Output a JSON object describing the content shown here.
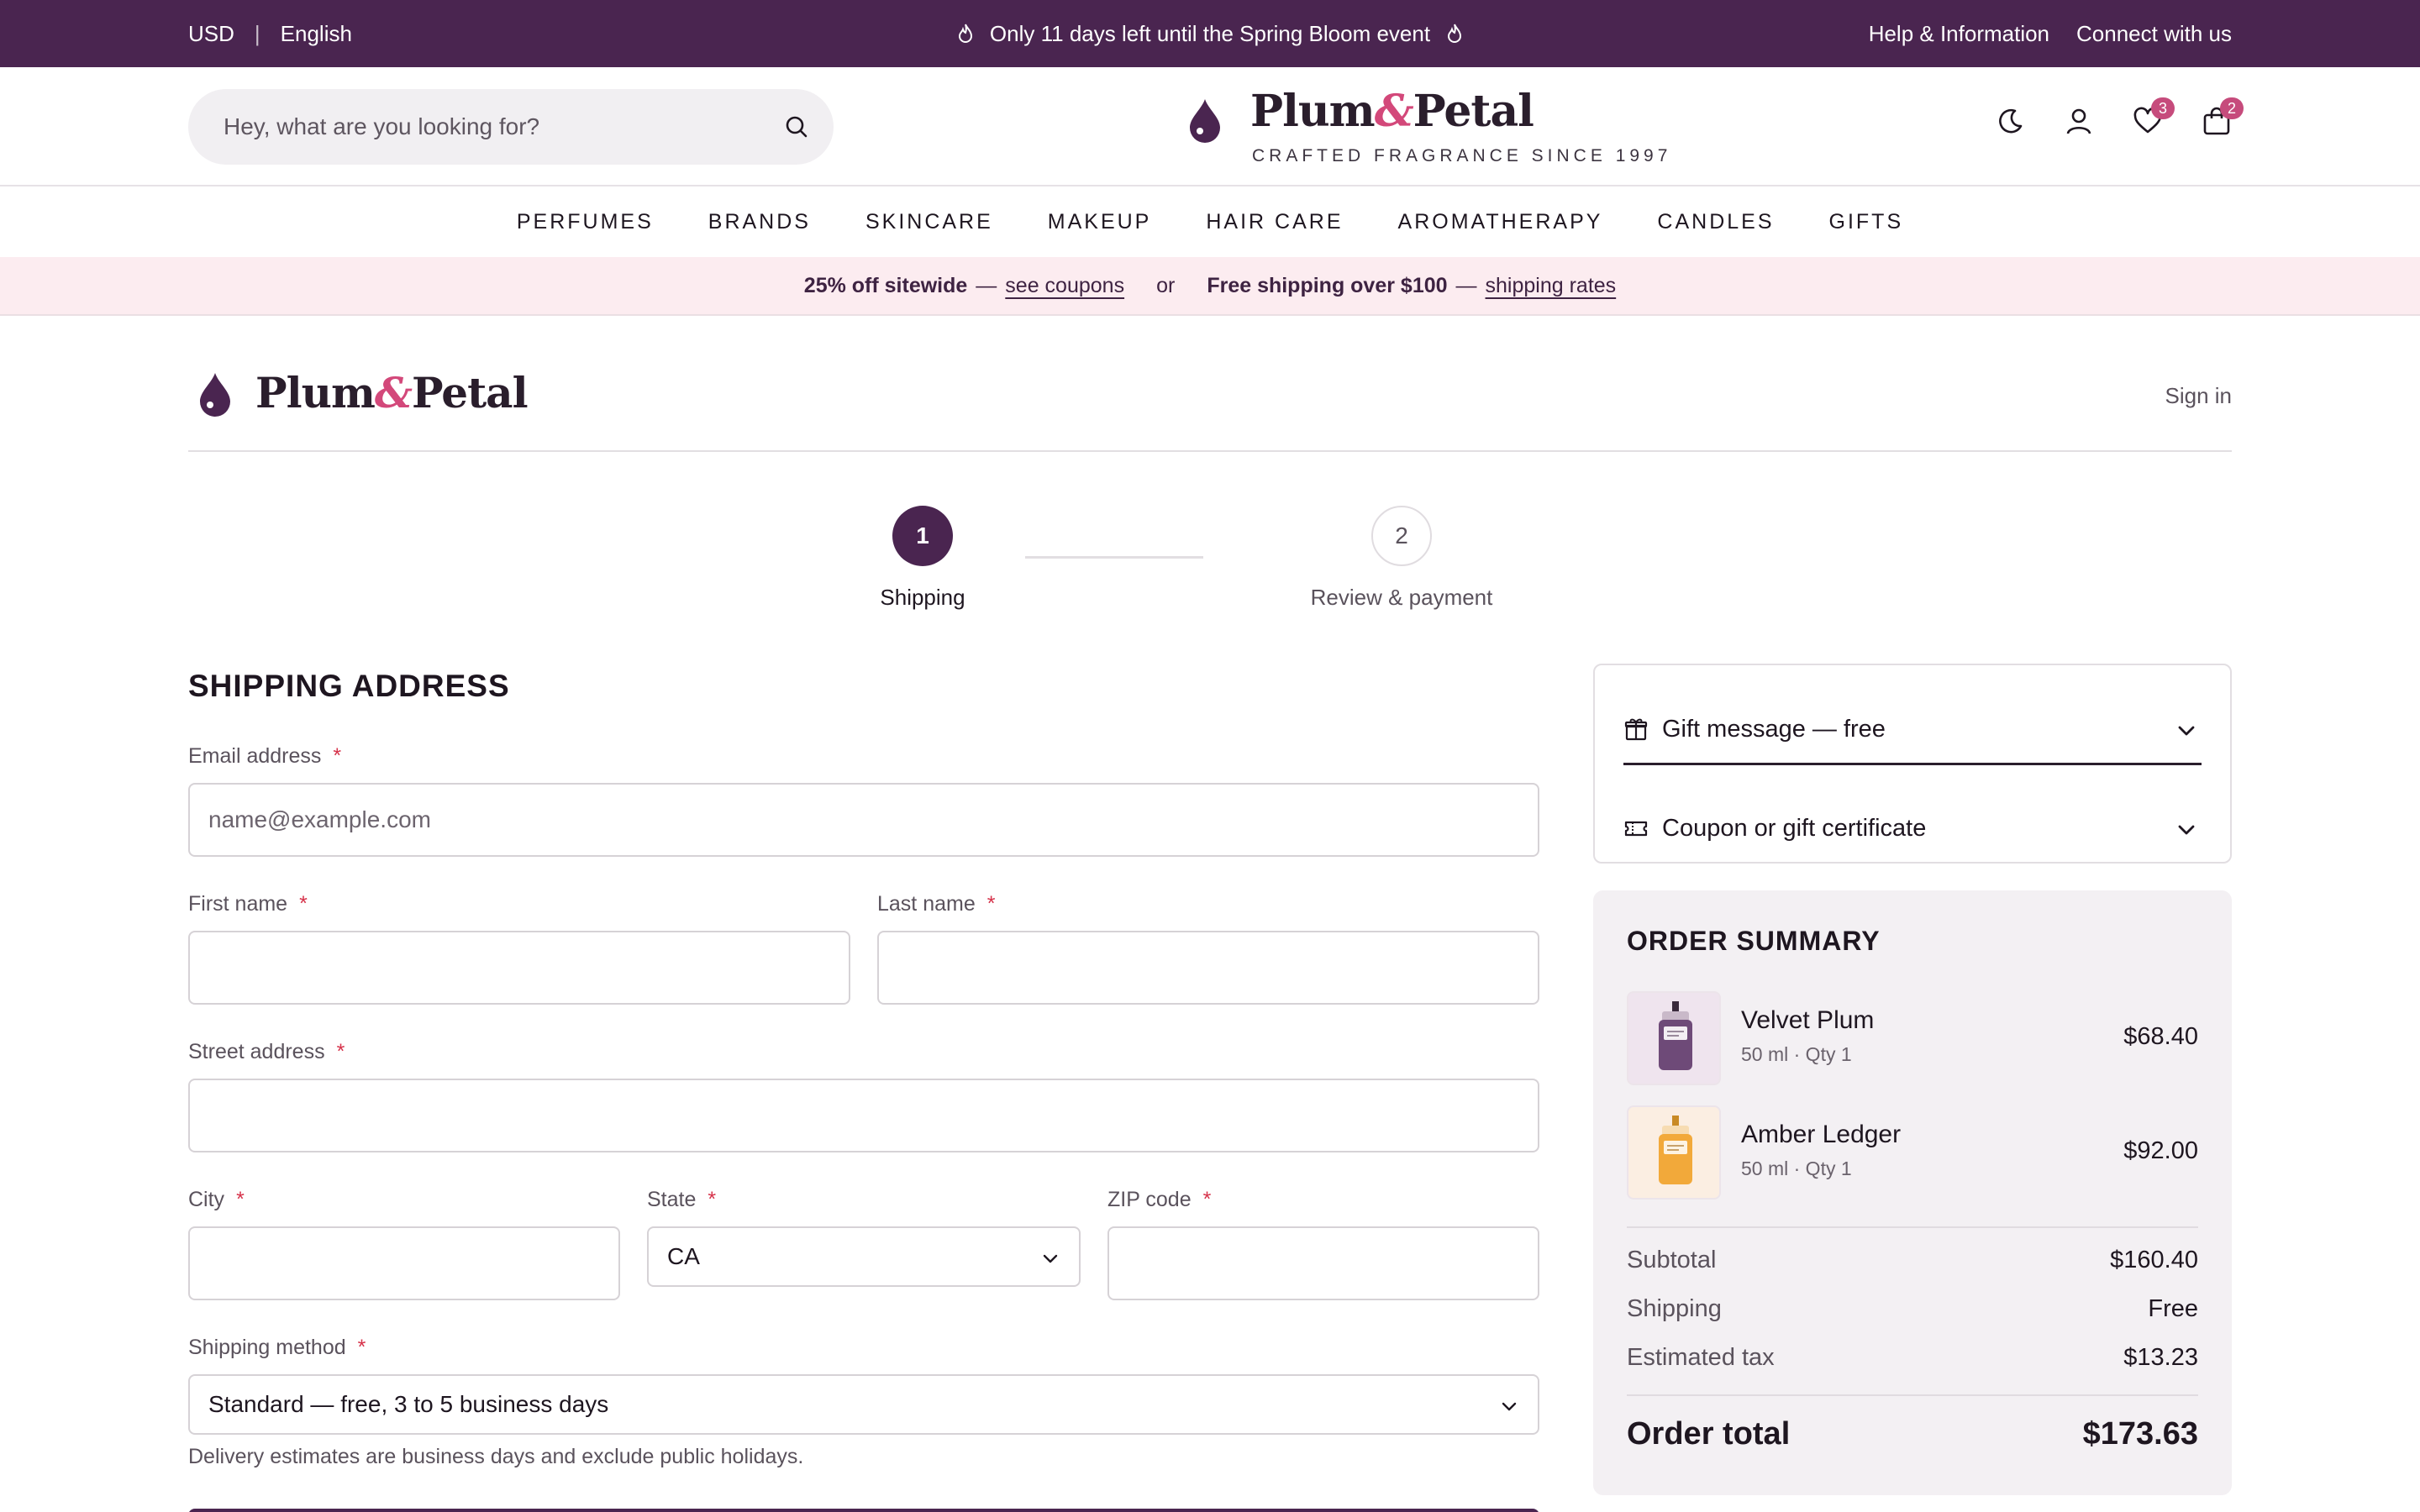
{
  "topbar": {
    "currency": "USD",
    "separator": "|",
    "language": "English",
    "announcement": "Only 11 days left until the Spring Bloom event",
    "help": "Help & Information",
    "connect": "Connect with us"
  },
  "header": {
    "search_placeholder": "Hey, what are you looking for?",
    "brand_name_a": "Plum",
    "brand_amp": "&",
    "brand_name_b": "Petal",
    "brand_tagline": "CRAFTED FRAGRANCE SINCE 1997",
    "wishlist_count": "3",
    "cart_count": "2"
  },
  "nav": {
    "items": [
      "PERFUMES",
      "BRANDS",
      "SKINCARE",
      "MAKEUP",
      "HAIR CARE",
      "AROMATHERAPY",
      "CANDLES",
      "GIFTS"
    ]
  },
  "promo": {
    "offer1": "25% off sitewide",
    "dash1": "—",
    "link1": "see coupons",
    "or": "or",
    "offer2": "Free shipping over $100",
    "dash2": "—",
    "link2": "shipping rates"
  },
  "checkout": {
    "sign_in": "Sign in",
    "steps": [
      {
        "number": "1",
        "label": "Shipping",
        "active": true
      },
      {
        "number": "2",
        "label": "Review & payment",
        "active": false
      }
    ]
  },
  "form": {
    "heading": "SHIPPING ADDRESS",
    "required_mark": "*",
    "email": {
      "label": "Email address",
      "placeholder": "name@example.com",
      "value": ""
    },
    "first_name": {
      "label": "First name",
      "value": ""
    },
    "last_name": {
      "label": "Last name",
      "value": ""
    },
    "street": {
      "label": "Street address",
      "value": ""
    },
    "city": {
      "label": "City",
      "value": ""
    },
    "state": {
      "label": "State",
      "value": "CA"
    },
    "zip": {
      "label": "ZIP code",
      "value": ""
    },
    "shipping_method": {
      "label": "Shipping method",
      "value": "Standard — free, 3 to 5 business days"
    },
    "note": "Delivery estimates are business days and exclude public holidays."
  },
  "accordion": {
    "gift": "Gift message — free",
    "coupon": "Coupon or gift certificate"
  },
  "summary": {
    "title": "ORDER SUMMARY",
    "items": [
      {
        "name": "Velvet Plum",
        "meta": "50 ml · Qty 1",
        "price": "$68.40",
        "color": "#6e4a78",
        "bg": "#efe4ee"
      },
      {
        "name": "Amber Ledger",
        "meta": "50 ml · Qty 1",
        "price": "$92.00",
        "color": "#f2a93a",
        "bg": "#fbeee2"
      }
    ],
    "subtotal_label": "Subtotal",
    "subtotal": "$160.40",
    "shipping_label": "Shipping",
    "shipping": "Free",
    "tax_label": "Estimated tax",
    "tax": "$13.23",
    "total_label": "Order total",
    "total": "$173.63"
  },
  "colors": {
    "brand": "#4a2550",
    "accent": "#c64b7c",
    "promo_bg": "#fcecf0"
  }
}
